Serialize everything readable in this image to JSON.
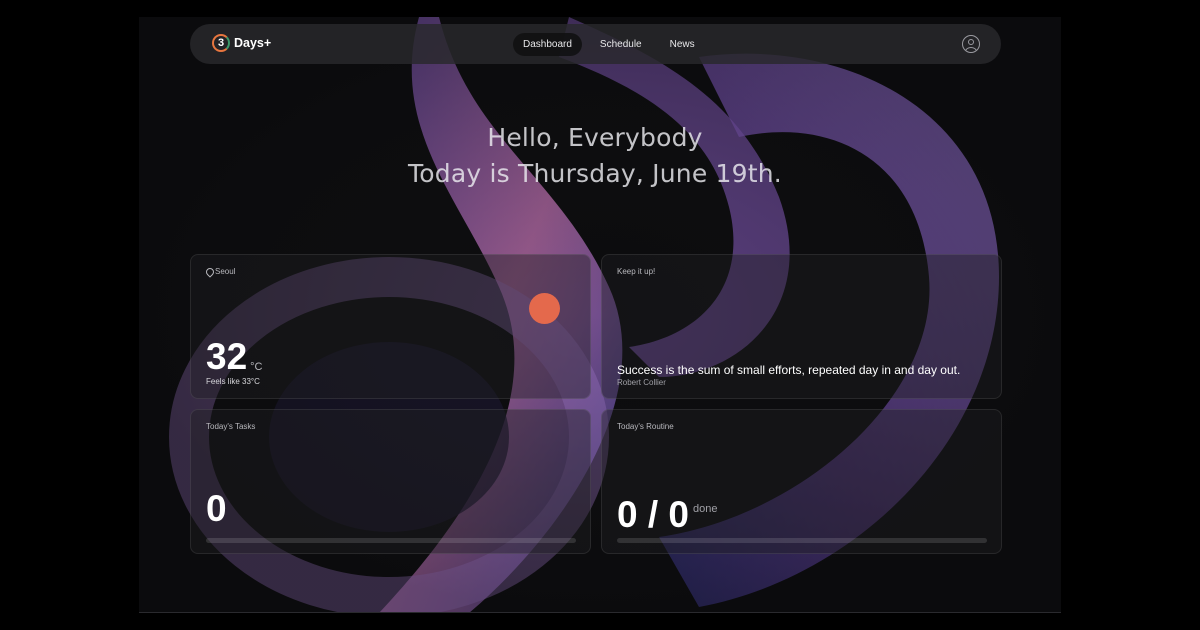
{
  "app": {
    "logo_mark": "3",
    "logo_text": "Days+"
  },
  "nav": {
    "items": [
      {
        "label": "Dashboard",
        "active": true
      },
      {
        "label": "Schedule",
        "active": false
      },
      {
        "label": "News",
        "active": false
      }
    ]
  },
  "greeting": {
    "line1": "Hello, Everybody",
    "line2": "Today is Thursday, June 19th."
  },
  "weather": {
    "city": "Seoul",
    "temp": "32",
    "unit": "°C",
    "feels": "Feels like 33°C",
    "sun_color": "#e4694c"
  },
  "quote": {
    "label": "Keep it up!",
    "text": "Success is the sum of small efforts, repeated day in and day out.",
    "author": "Robert Collier"
  },
  "tasks": {
    "label": "Today's Tasks",
    "count": "0",
    "progress": 0
  },
  "routine": {
    "label": "Today's Routine",
    "count": "0 / 0",
    "suffix": "done",
    "progress": 0
  },
  "colors": {
    "accent": "#e4694c",
    "logo_green": "#3a9a6a"
  }
}
